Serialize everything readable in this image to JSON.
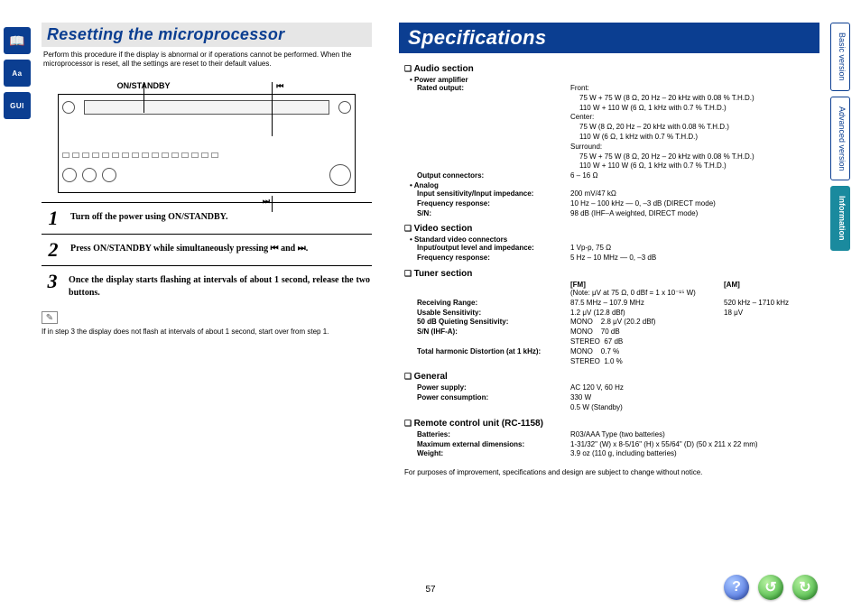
{
  "page_number": "57",
  "left_strip": {
    "icon1": "📖",
    "icon2": "Aa",
    "icon3": "GUI"
  },
  "side_tabs": {
    "basic": "Basic version",
    "advanced": "Advanced version",
    "information": "Information"
  },
  "reset": {
    "title": "Resetting the microprocessor",
    "intro": "Perform this procedure if the display is abnormal or if operations cannot be performed. When the microprocessor is reset, all the settings are reset to their default values.",
    "label_on_standby": "ON/STANDBY",
    "label_prev": "⏮",
    "label_next": "⏭",
    "steps": {
      "s1_num": "1",
      "s1_body": "Turn off the power using ON/STANDBY.",
      "s2_num": "2",
      "s2_body": "Press ON/STANDBY while simultaneously pressing ⏮ and ⏭.",
      "s3_num": "3",
      "s3_body": "Once the display starts flashing at intervals of about 1 second, release the two buttons."
    },
    "note_icon": "✎",
    "note": "If in step 3 the display does not flash at intervals of about 1 second, start over from step 1."
  },
  "spec": {
    "title": "Specifications",
    "audio": {
      "heading": "Audio section",
      "bullet_amp": "Power amplifier",
      "rated_output_label": "Rated output:",
      "front_label": "Front:",
      "front_l1": "75 W + 75 W (8 Ω, 20 Hz – 20 kHz with 0.08 % T.H.D.)",
      "front_l2": "110 W + 110 W (6 Ω, 1 kHz with 0.7 % T.H.D.)",
      "center_label": "Center:",
      "center_l1": "75 W (8 Ω, 20 Hz – 20 kHz with 0.08 % T.H.D.)",
      "center_l2": "110 W (6 Ω, 1 kHz with 0.7 % T.H.D.)",
      "surround_label": "Surround:",
      "surround_l1": "75 W + 75 W (8 Ω, 20 Hz – 20 kHz with 0.08 % T.H.D.)",
      "surround_l2": "110 W + 110 W (6 Ω, 1 kHz with 0.7 % T.H.D.)",
      "out_conn_label": "Output connectors:",
      "out_conn": "6 – 16 Ω",
      "bullet_analog": "Analog",
      "inp_sens_label": "Input sensitivity/Input impedance:",
      "inp_sens": "200 mV/47 kΩ",
      "freq_resp_label": "Frequency response:",
      "freq_resp": "10 Hz – 100 kHz — 0, –3 dB (DIRECT mode)",
      "sn_label": "S/N:",
      "sn": "98 dB (IHF–A weighted, DIRECT mode)"
    },
    "video": {
      "heading": "Video section",
      "bullet_std": "Standard video connectors",
      "io_label": "Input/output level and impedance:",
      "io": "1 Vp-p, 75 Ω",
      "freq_label": "Frequency response:",
      "freq": "5 Hz – 10 MHz — 0, –3 dB"
    },
    "tuner": {
      "heading": "Tuner section",
      "fm": "[FM]",
      "am": "[AM]",
      "note": "(Note: μV at 75 Ω, 0 dBf = 1 x 10⁻¹⁵ W)",
      "range_label": "Receiving Range:",
      "range_fm": "87.5 MHz – 107.9 MHz",
      "range_am": "520 kHz – 1710 kHz",
      "usable_label": "Usable Sensitivity:",
      "usable_fm": "1.2 μV (12.8 dBf)",
      "usable_am": "18 μV",
      "quiet_label": "50 dB Quieting Sensitivity:",
      "quiet_fm": "MONO    2.8 μV (20.2 dBf)",
      "snihf_label": "S/N (IHF-A):",
      "snihf_mono": "MONO    70 dB",
      "snihf_stereo": "STEREO  67 dB",
      "thd_label": "Total harmonic Distortion (at 1 kHz):",
      "thd_mono": "MONO    0.7 %",
      "thd_stereo": "STEREO  1.0 %"
    },
    "general": {
      "heading": "General",
      "supply_label": "Power supply:",
      "supply": "AC 120 V, 60 Hz",
      "cons_label": "Power consumption:",
      "cons": "330 W",
      "cons2": "0.5 W (Standby)"
    },
    "remote": {
      "heading": "Remote control unit (RC-1158)",
      "batt_label": "Batteries:",
      "batt": "R03/AAA Type (two batteries)",
      "dim_label": "Maximum external dimensions:",
      "dim": "1-31/32\" (W) x 8-5/16\" (H) x 55/64\" (D) (50 x 211 x 22 mm)",
      "weight_label": "Weight:",
      "weight": "3.9 oz (110 g, including batteries)"
    },
    "disclaimer": "For purposes of improvement, specifications and design are subject to change without notice."
  },
  "footer": {
    "help": "?",
    "back": "↺",
    "fwd": "↻"
  }
}
